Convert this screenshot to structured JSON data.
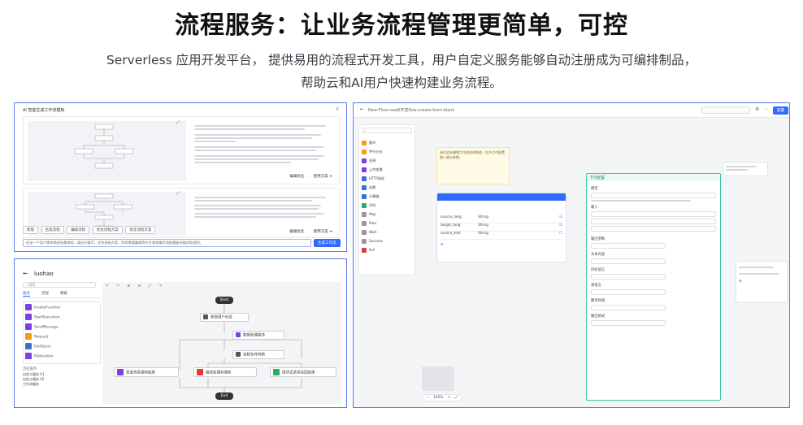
{
  "heading": {
    "title": "流程服务：让业务流程管理更简单，可控",
    "subtitle_line1": "Serverless 应用开发平台， 提供易用的流程式开发工具，用户自定义服务能够自动注册成为可编排制品，",
    "subtitle_line2": "帮助云和AI用户快速构建业务流程。"
  },
  "panel_ai": {
    "header": "AI 智能生成工作流模板",
    "card1_actions": [
      "编辑优化",
      "使用方案 ➔"
    ],
    "card2_actions": [
      "编辑优化",
      "使用方案 ➔"
    ],
    "chips": [
      "智能",
      "生成流程",
      "编排流程",
      "优化流程方案",
      "优化流程方案"
    ],
    "input_placeholder": "在这一个用户需求描述场景流程，请自行填写，优先采纳方案，同时需要编辑等中文相关编写流程模板的描述和说明。",
    "generate_button": "生成工作流"
  },
  "panel_luohao": {
    "title": "luohao",
    "search_placeholder": "搜索",
    "tabs": [
      "服务",
      "流程",
      "模板"
    ],
    "services": [
      "InvokeFunction",
      "StartExecution",
      "SendMessage",
      "Request",
      "PutObject",
      "Publication"
    ],
    "section_label": "流程服务",
    "extra_items": [
      "自定义服务 01",
      "自定义服务 02",
      "工作流服务"
    ],
    "nodes": {
      "start": "Start",
      "n1": "获取用户信息",
      "n2": "数据处理服务",
      "n3": "流程条件判断",
      "n4": "发送消息通知结果",
      "n5": "错误处理并通知",
      "n6": "成功记录并返回结果",
      "end": "End"
    }
  },
  "panel_flow": {
    "breadcrumb": "New-Flow-new6开发flow-create-from-blank",
    "top_button": "部署",
    "palette": [
      "循环",
      "并行分支",
      "选择",
      "上传变量",
      "HTTP请求",
      "函数",
      "计算器",
      "代码",
      "Map",
      "Pass",
      "Wait",
      "Success",
      "Fail"
    ],
    "note": "请在此处编辑工作流说明描述，在节点中配置输入输出参数。",
    "table_rows": [
      "source_lang",
      "target_lang",
      "source_text"
    ],
    "type_col": "String",
    "config_title": "节点配置",
    "config_sections": [
      "模型",
      "输入",
      "输出参数",
      "文本内容",
      "目标语言",
      "源语言",
      "翻译风格",
      "输出格式"
    ],
    "zoom": "100%"
  },
  "colors": {
    "accent": "#2f6bff",
    "border": "#5b7cf0",
    "node_purple": "#7b3fe4",
    "node_red": "#e53935",
    "node_green": "#27ae60"
  }
}
